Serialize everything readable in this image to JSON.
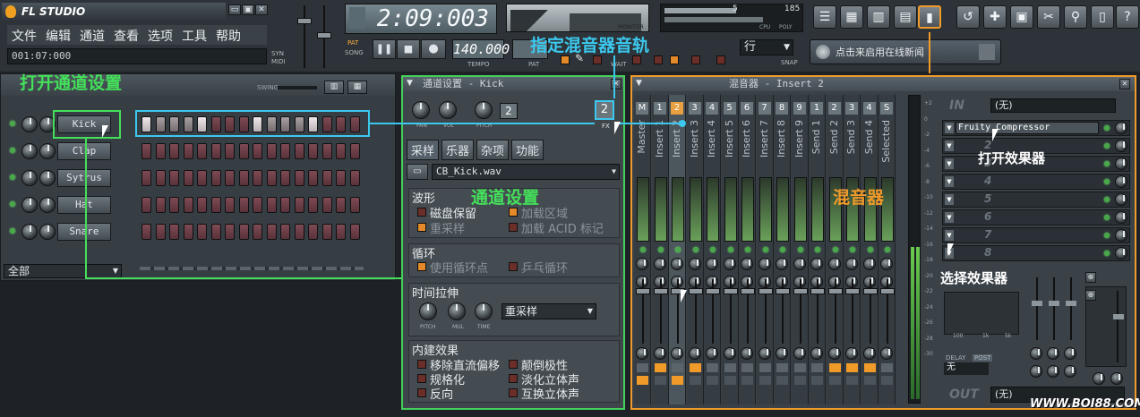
{
  "app": {
    "logo": "FL STUDIO",
    "menu": [
      "文件",
      "编辑",
      "通道",
      "查看",
      "选项",
      "工具",
      "帮助"
    ],
    "song_position": "001:07:000",
    "time_display": "2:09:003",
    "tempo": "140.000",
    "tempo_label": "TEMPO",
    "pat_label": "PAT",
    "song_label": "SONG",
    "syn_label": "SYN",
    "midi_label": "MIDI",
    "monitor_label": "MONITOR",
    "cpu_label": "CPU",
    "poly_label": "POLY",
    "cpu_value": "5",
    "poly_value": "185",
    "snap_select": "行",
    "snap_label": "SNAP",
    "wait_label": "WAIT",
    "online_hint": "点击来启用在线新闻",
    "swing_label": "SWING"
  },
  "annotations": {
    "open_channel_settings": "打开通道设置",
    "assign_mixer_track": "指定混音器音轨",
    "channel_settings": "通道设置",
    "mixer": "混音器",
    "open_effect": "打开效果器",
    "select_effect": "选择效果器"
  },
  "step_sequencer": {
    "channels": [
      {
        "name": "Kick"
      },
      {
        "name": "Clap"
      },
      {
        "name": "Sytrus"
      },
      {
        "name": "Hat"
      },
      {
        "name": "Snare"
      }
    ],
    "filter": "全部",
    "kick_steps": [
      1,
      0,
      0,
      0,
      1,
      0,
      0,
      0,
      1,
      0,
      0,
      0,
      1,
      0,
      0,
      0
    ]
  },
  "channel_settings": {
    "title": "通道设置 - Kick",
    "knob_labels": [
      "PAN",
      "VOL",
      "PITCH"
    ],
    "fx_number": "2",
    "fx_label": "FX",
    "tabs": [
      "采样",
      "乐器",
      "杂项",
      "功能"
    ],
    "sample_file": "CB_Kick.wav",
    "waveform_section": "波形",
    "waveform_options": [
      {
        "label": "磁盘保留",
        "checked": false
      },
      {
        "label": "加载区域",
        "checked": true
      },
      {
        "label": "重采样",
        "checked": true
      },
      {
        "label": "加载 ACID 标记",
        "checked": false
      }
    ],
    "loop_section": "循环",
    "loop_options": [
      {
        "label": "使用循环点",
        "checked": true
      },
      {
        "label": "乒乓循环",
        "checked": false
      }
    ],
    "timestretch_section": "时间拉伸",
    "timestretch_knobs": [
      "PITCH",
      "MUL",
      "TIME"
    ],
    "timestretch_mode": "重采样",
    "builtin_section": "内建效果",
    "builtin_options": [
      {
        "label": "移除直流偏移",
        "checked": false
      },
      {
        "label": "颠倒极性",
        "checked": false
      },
      {
        "label": "规格化",
        "checked": false
      },
      {
        "label": "淡化立体声",
        "checked": false
      },
      {
        "label": "反向",
        "checked": false
      },
      {
        "label": "互换立体声",
        "checked": false
      }
    ]
  },
  "mixer": {
    "title": "混音器 - Insert 2",
    "tracks": [
      {
        "name": "Master",
        "ins": "M"
      },
      {
        "name": "Insert 1",
        "ins": "1"
      },
      {
        "name": "Insert 2",
        "ins": "2"
      },
      {
        "name": "Insert 3",
        "ins": "3"
      },
      {
        "name": "Insert 4",
        "ins": "4"
      },
      {
        "name": "Insert 5",
        "ins": "5"
      },
      {
        "name": "Insert 6",
        "ins": "6"
      },
      {
        "name": "Insert 7",
        "ins": "7"
      },
      {
        "name": "Insert 8",
        "ins": "8"
      },
      {
        "name": "Insert 9",
        "ins": "9"
      },
      {
        "name": "Send 1",
        "ins": "1"
      },
      {
        "name": "Send 2",
        "ins": "2"
      },
      {
        "name": "Send 3",
        "ins": "3"
      },
      {
        "name": "Send 4",
        "ins": "4"
      },
      {
        "name": "Selected",
        "ins": "S"
      }
    ],
    "in_label": "IN",
    "in_value": "(无)",
    "out_label": "OUT",
    "out_value": "(无)",
    "slots": [
      "Fruity Compressor",
      "2",
      "3",
      "4",
      "5",
      "6",
      "7",
      "8"
    ],
    "delay_label": "DELAY",
    "post_label": "POST",
    "delay_value": "无",
    "eq_labels": [
      "100",
      "1k",
      "5k"
    ],
    "db_scale": [
      "+2",
      "0",
      "-2",
      "-4",
      "-6",
      "-8",
      "-10",
      "-12",
      "-14",
      "-16",
      "-18",
      "-20",
      "-22",
      "-24",
      "-26",
      "-28",
      "-30"
    ]
  },
  "watermark": "WWW.BOI88.COM"
}
